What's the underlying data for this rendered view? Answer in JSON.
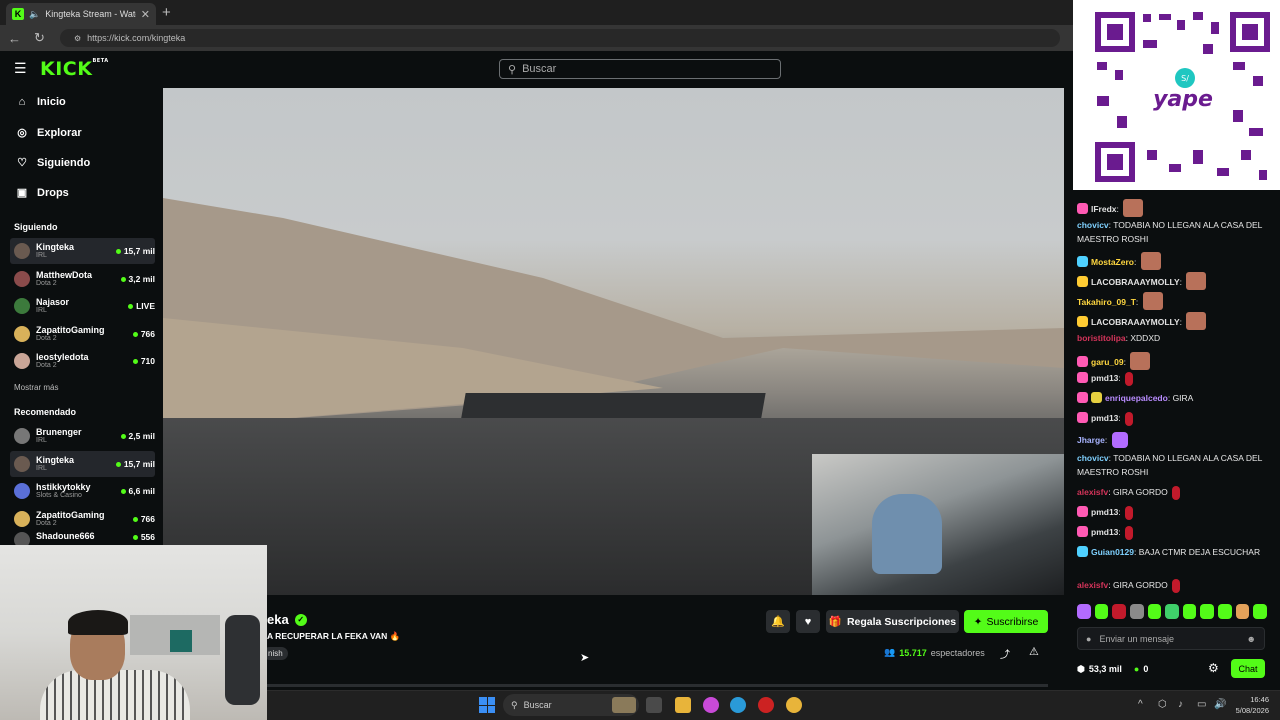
{
  "browser": {
    "tab_title": "Kingteka Stream - Watch Live",
    "tab_close": "✕",
    "new_tab": "+",
    "url": "https://kick.com/kingteka"
  },
  "header": {
    "logo": "KICK",
    "logo_tag": "BETA",
    "search_placeholder": "Buscar"
  },
  "sidebar": {
    "nav": [
      {
        "label": "Inicio",
        "icon": "home-icon"
      },
      {
        "label": "Explorar",
        "icon": "compass-icon"
      },
      {
        "label": "Siguiendo",
        "icon": "heart-icon"
      },
      {
        "label": "Drops",
        "icon": "gift-icon"
      }
    ],
    "following_title": "Siguiendo",
    "following": [
      {
        "name": "Kingteka",
        "category": "IRL",
        "viewers": "15,7 mil"
      },
      {
        "name": "MatthewDota",
        "category": "Dota 2",
        "viewers": "3,2 mil"
      },
      {
        "name": "Najasor",
        "category": "IRL",
        "viewers": "LIVE"
      },
      {
        "name": "ZapatitoGaming",
        "category": "Dota 2",
        "viewers": "766"
      },
      {
        "name": "leostyledota",
        "category": "Dota 2",
        "viewers": "710"
      }
    ],
    "show_more": "Mostrar más",
    "recommended_title": "Recomendado",
    "recommended": [
      {
        "name": "Brunenger",
        "category": "IRL",
        "viewers": "2,5 mil"
      },
      {
        "name": "Kingteka",
        "category": "IRL",
        "viewers": "15,7 mil"
      },
      {
        "name": "hstikkytokky",
        "category": "Slots & Casino",
        "viewers": "6,6 mil"
      },
      {
        "name": "ZapatitoGaming",
        "category": "Dota 2",
        "viewers": "766"
      },
      {
        "name": "Shadoune666",
        "category": "",
        "viewers": "556"
      }
    ]
  },
  "stream": {
    "streamer": "eka",
    "title": "A RECUPERAR LA FEKA VAN 🔥",
    "language": "nish",
    "gift_label": "Regala Suscripciones",
    "subscribe_label": "Suscribirse",
    "viewers_count": "15.717",
    "viewers_label": "espectadores"
  },
  "chat": {
    "messages": [
      {
        "user": "lFredx",
        "color": "#e2e2e2",
        "text": "",
        "badge": "#ff5ab4",
        "emote": "face"
      },
      {
        "user": "chovicv",
        "color": "#7fd1ff",
        "text": "TODABIA NO LLEGAN ALA CASA DEL MAESTRO ROSHI",
        "badge": "",
        "emote": ""
      },
      {
        "user": "MostaZero",
        "color": "#ffd740",
        "text": "",
        "badge": "#4fd1ff",
        "emote": "face"
      },
      {
        "user": "LACOBRAAAYMOLLY",
        "color": "#e2e2e2",
        "text": "",
        "badge": "#ffcc33",
        "emote": "face"
      },
      {
        "user": "Takahiro_09_T",
        "color": "#ffd740",
        "text": "",
        "badge": "",
        "emote": "face"
      },
      {
        "user": "LACOBRAAAYMOLLY",
        "color": "#e2e2e2",
        "text": "",
        "badge": "#ffcc33",
        "emote": "face"
      },
      {
        "user": "boristitolipa",
        "color": "#d4345a",
        "text": "XDDXD",
        "badge": "",
        "emote": ""
      },
      {
        "user": "garu_09",
        "color": "#ffd740",
        "text": "",
        "badge": "#ff5ab4",
        "emote": "face"
      },
      {
        "user": "pmd13",
        "color": "#e2e2e2",
        "text": "",
        "badge": "#ff5ab4",
        "emote": "small"
      },
      {
        "user": "enriquepalcedo",
        "color": "#b98cff",
        "text": "GIRA",
        "badge": "#ff5ab4",
        "emote": ""
      },
      {
        "user": "pmd13",
        "color": "#e2e2e2",
        "text": "",
        "badge": "#ff5ab4",
        "emote": "small"
      },
      {
        "user": "Jharge",
        "color": "#a8b4ff",
        "text": "",
        "badge": "",
        "emote": "purple"
      },
      {
        "user": "chovicv",
        "color": "#7fd1ff",
        "text": "TODABIA NO LLEGAN ALA CASA DEL MAESTRO ROSHI",
        "badge": "",
        "emote": ""
      },
      {
        "user": "alexisfv",
        "color": "#d4345a",
        "text": "GIRA GORDO",
        "badge": "",
        "emote": "small"
      },
      {
        "user": "pmd13",
        "color": "#e2e2e2",
        "text": "",
        "badge": "#ff5ab4",
        "emote": "small"
      },
      {
        "user": "pmd13",
        "color": "#e2e2e2",
        "text": "",
        "badge": "#ff5ab4",
        "emote": "small"
      },
      {
        "user": "Guian0129",
        "color": "#7fd1ff",
        "text": "BAJA CTMR DEJA ESCUCHAR",
        "badge": "#4fd1ff",
        "emote": ""
      },
      {
        "user": "alexisfv",
        "color": "#d4345a",
        "text": "GIRA GORDO",
        "badge": "",
        "emote": "small"
      }
    ],
    "input_placeholder": "Enviar un mensaje",
    "points": "53,3 mil",
    "points_secondary": "0",
    "chat_button": "Chat"
  },
  "taskbar": {
    "search_placeholder": "Buscar",
    "time": "16:46",
    "date": "5/08/2026"
  },
  "colors": {
    "accent": "#53fc18",
    "background": "#0b0e0f"
  }
}
